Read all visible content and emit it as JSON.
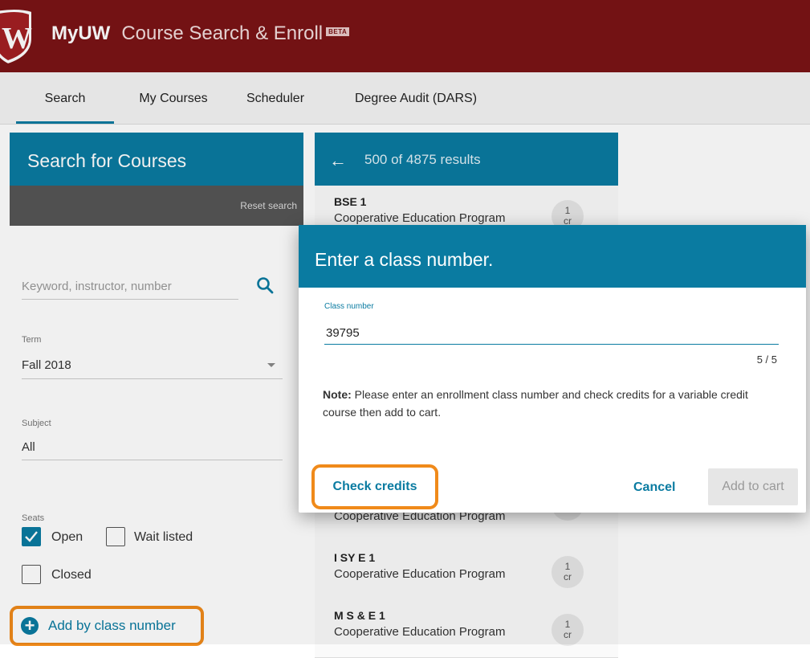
{
  "header": {
    "brand": "MyUW",
    "title": "Course Search & Enroll",
    "badge": "BETA"
  },
  "tabs": [
    {
      "label": "Search",
      "active": true
    },
    {
      "label": "My Courses"
    },
    {
      "label": "Scheduler"
    },
    {
      "label": "Degree Audit (DARS)"
    }
  ],
  "search_panel": {
    "title": "Search for Courses",
    "reset_label": "Reset search",
    "keyword_placeholder": "Keyword, instructor, number",
    "term_label": "Term",
    "term_value": "Fall 2018",
    "subject_label": "Subject",
    "subject_value": "All",
    "seats_label": "Seats",
    "seat_open": "Open",
    "seat_waitlisted": "Wait listed",
    "seat_closed": "Closed",
    "add_by_class": "Add by class number"
  },
  "results_panel": {
    "count_text": "500 of 4875 results",
    "items": [
      {
        "code": "BSE 1",
        "name": "Cooperative Education Program",
        "credit_num": "1",
        "credit_unit": "cr"
      },
      {
        "code": "",
        "name": "Cooperative Education Program",
        "credit_num": "",
        "credit_unit": "cr"
      },
      {
        "code": "I SY E 1",
        "name": "Cooperative Education Program",
        "credit_num": "1",
        "credit_unit": "cr"
      },
      {
        "code": "M S & E 1",
        "name": "Cooperative Education Program",
        "credit_num": "1",
        "credit_unit": "cr"
      }
    ]
  },
  "modal": {
    "title": "Enter a class number.",
    "field_label": "Class number",
    "field_value": "39795",
    "counter": "5 / 5",
    "note_bold": "Note:",
    "note_text": " Please enter an enrollment class number and check credits for a variable credit course then add to cart.",
    "check_credits": "Check credits",
    "cancel": "Cancel",
    "add_to_cart": "Add to cart"
  },
  "colors": {
    "header_bg": "#7b1416",
    "accent": "#0a7ba1",
    "highlight": "#f08a1a"
  }
}
